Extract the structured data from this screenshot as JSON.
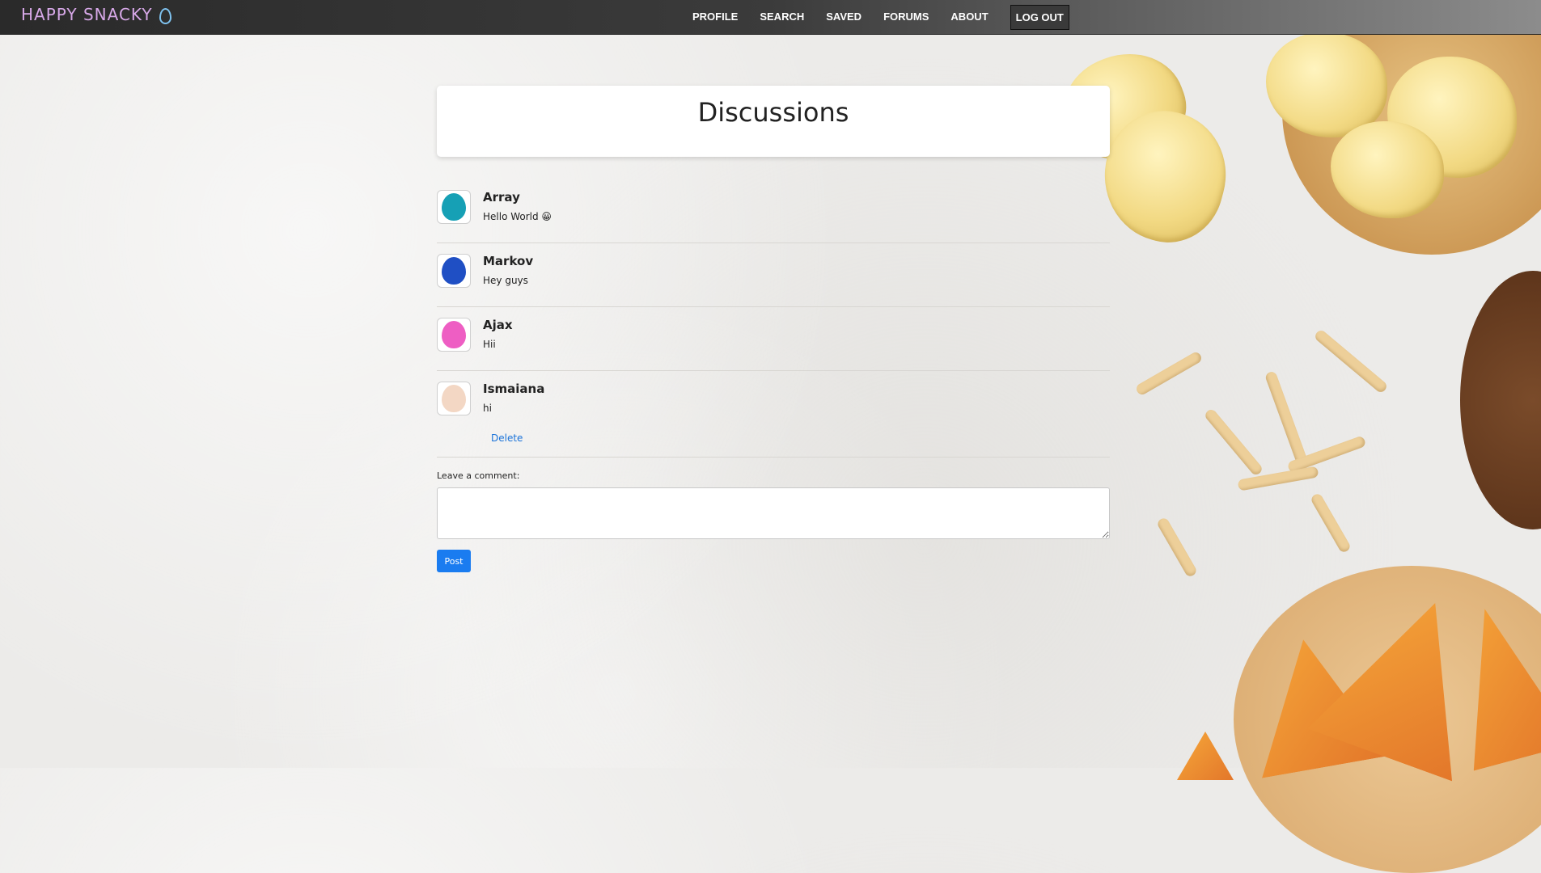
{
  "navbar": {
    "brand": "HAPPY SNACKY",
    "items": [
      {
        "label": "PROFILE"
      },
      {
        "label": "SEARCH"
      },
      {
        "label": "SAVED"
      },
      {
        "label": "FORUMS"
      },
      {
        "label": "ABOUT"
      }
    ],
    "logout_label": "LOG OUT"
  },
  "page": {
    "title": "Discussions"
  },
  "comments": [
    {
      "user": "Array",
      "text": "Hello World 😀",
      "avatar_color": "#16a0b5"
    },
    {
      "user": "Markov",
      "text": "Hey guys",
      "avatar_color": "#1f4fc4"
    },
    {
      "user": "Ajax",
      "text": "Hii",
      "avatar_color": "#ee5ec3"
    },
    {
      "user": "Ismaiana",
      "text": "hi",
      "avatar_color": "#f3d7c4",
      "delete_label": "Delete"
    }
  ],
  "comment_form": {
    "label": "Leave a comment:",
    "value": "",
    "submit_label": "Post"
  },
  "colors": {
    "primary": "#1a7cf0",
    "navbar_dark": "#2a2a2a"
  }
}
